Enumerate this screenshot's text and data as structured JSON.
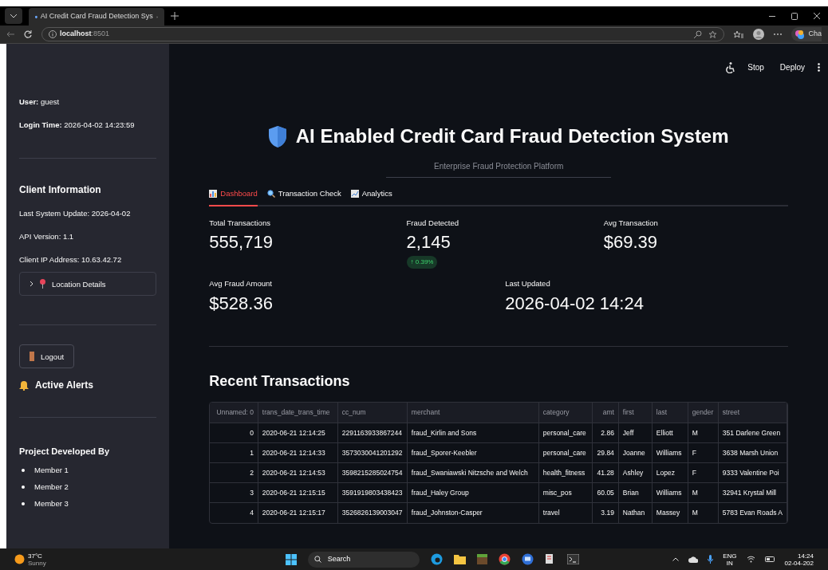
{
  "browser": {
    "tab_title": "AI Credit Card Fraud Detection Sys",
    "url_host": "localhost",
    "url_port": ":8501",
    "profile_button": "Cha"
  },
  "app_toolbar": {
    "buttons": [
      "Stop",
      "Deploy"
    ]
  },
  "sidebar": {
    "session": [
      {
        "label": "User:",
        "value": "guest"
      },
      {
        "label": "Login Time:",
        "value": "2026-04-02 14:23:59"
      }
    ],
    "client_info": {
      "title": "Client Information",
      "lines": [
        "Last System Update: 2026-04-02",
        "API Version: 1.1",
        "Client IP Address: 10.63.42.72"
      ]
    },
    "expander": {
      "label": "Location Details",
      "expanded": false
    },
    "logout_button": "Logout",
    "alerts_title": "Active Alerts",
    "developers": {
      "title": "Project Developed By",
      "members": [
        "Member 1",
        "Member 2",
        "Member 3"
      ]
    }
  },
  "header": {
    "title": "AI Enabled Credit Card Fraud Detection System",
    "subtitle": "Enterprise Fraud Protection Platform"
  },
  "tabs": [
    {
      "label": "Dashboard",
      "kind": "chart",
      "selected": true
    },
    {
      "label": "Transaction Check",
      "kind": "search",
      "selected": false
    },
    {
      "label": "Analytics",
      "kind": "trend",
      "selected": false
    }
  ],
  "metric_rows": [
    [
      {
        "label": "Total Transactions",
        "value": "555,719"
      },
      {
        "label": "Fraud Detected",
        "value": "2,145",
        "delta": "↑ 0.39%"
      },
      {
        "label": "Avg Transaction",
        "value": "$69.39"
      }
    ],
    [
      {
        "label": "Avg Fraud Amount",
        "value": "$528.36"
      },
      {
        "label": "Last Updated",
        "value": "2026-04-02 14:24"
      }
    ]
  ],
  "recent": {
    "title": "Recent Transactions",
    "columns": [
      {
        "name": "Unnamed: 0",
        "numeric": true
      },
      {
        "name": "trans_date_trans_time",
        "numeric": false
      },
      {
        "name": "cc_num",
        "numeric": false
      },
      {
        "name": "merchant",
        "numeric": false
      },
      {
        "name": "category",
        "numeric": false
      },
      {
        "name": "amt",
        "numeric": true
      },
      {
        "name": "first",
        "numeric": false
      },
      {
        "name": "last",
        "numeric": false
      },
      {
        "name": "gender",
        "numeric": false
      },
      {
        "name": "street",
        "numeric": false
      }
    ],
    "rows": [
      [
        "0",
        "2020-06-21 12:14:25",
        "2291163933867244",
        "fraud_Kirlin and Sons",
        "personal_care",
        "2.86",
        "Jeff",
        "Elliott",
        "M",
        "351 Darlene Green"
      ],
      [
        "1",
        "2020-06-21 12:14:33",
        "3573030041201292",
        "fraud_Sporer-Keebler",
        "personal_care",
        "29.84",
        "Joanne",
        "Williams",
        "F",
        "3638 Marsh Union"
      ],
      [
        "2",
        "2020-06-21 12:14:53",
        "3598215285024754",
        "fraud_Swaniawski Nitzsche and Welch",
        "health_fitness",
        "41.28",
        "Ashley",
        "Lopez",
        "F",
        "9333 Valentine Poi"
      ],
      [
        "3",
        "2020-06-21 12:15:15",
        "3591919803438423",
        "fraud_Haley Group",
        "misc_pos",
        "60.05",
        "Brian",
        "Williams",
        "M",
        "32941 Krystal Mill"
      ],
      [
        "4",
        "2020-06-21 12:15:17",
        "3526826139003047",
        "fraud_Johnston-Casper",
        "travel",
        "3.19",
        "Nathan",
        "Massey",
        "M",
        "5783 Evan Roads A"
      ]
    ]
  },
  "taskbar": {
    "temperature": "37°C",
    "condition": "Sunny",
    "search": "Search",
    "language": "ENG",
    "region": "IN",
    "time": "14:24",
    "date": "02-04-202"
  }
}
